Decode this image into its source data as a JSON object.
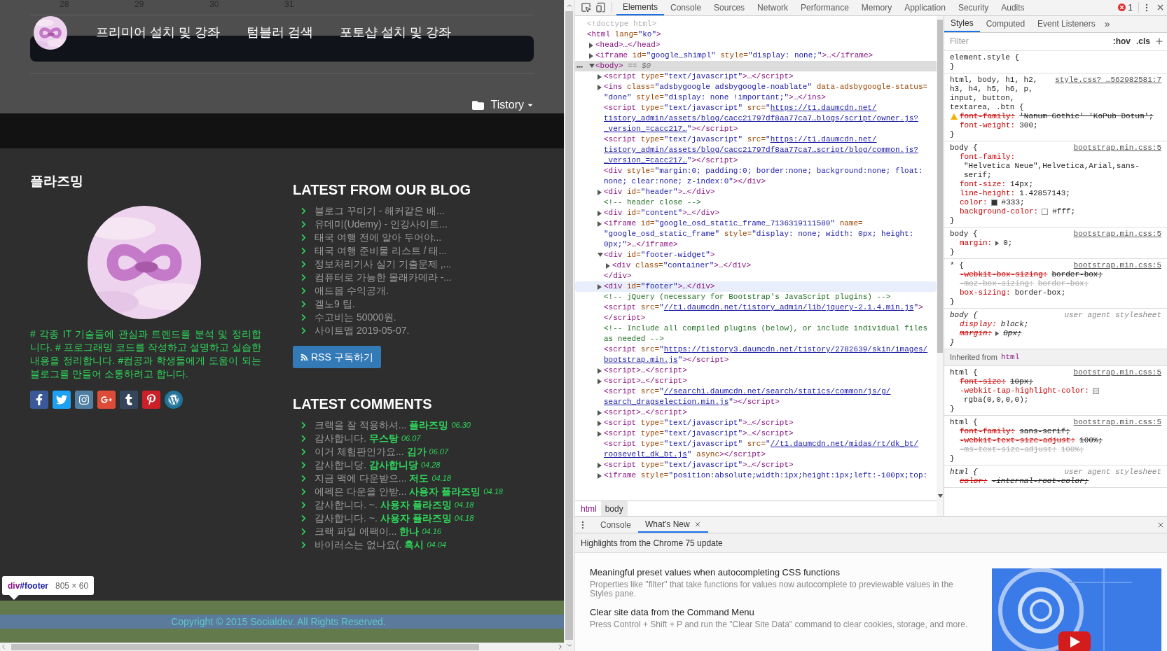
{
  "page": {
    "calendar_days": [
      "28",
      "29",
      "30",
      "31"
    ],
    "nav_items": [
      "프리미어 설치 및 강좌",
      "텀블러 검색",
      "포토샵 설치 및 강좌"
    ],
    "category": "Tistory",
    "about": {
      "title": "플라즈밍",
      "description": "# 각종 IT 기술들에 관심과 트렌드를 분석 및 정리합니다. # 프로그래밍 코드를 작성하고 설명하고 실습한 내용을 정리합니다. #컴공과 학생들에게 도움이 되는 블로그를 만들어 소통하려고 합니다."
    },
    "blog": {
      "title": "LATEST FROM OUR BLOG",
      "posts": [
        "블로그 꾸미기 - 해커같은 배...",
        "유데미(Udemy) - 인강사이트...",
        "태국 여행 전에 알아 두어야...",
        "태국 여행 준비물 리스트 / 태...",
        "정보처리기사 실기 기출문제 ,...",
        "컴퓨터로 가능한 몰래카메라 -...",
        "애드몹 수익공개.",
        "겔노9 팁.",
        "수고비는 50000원.",
        "사이트맵 2019-05-07."
      ],
      "rss_button": "RSS 구독하기"
    },
    "comments": {
      "title": "LATEST COMMENTS",
      "items": [
        {
          "text": "크랙을 잘 적용하셔...",
          "author": "플라즈밍",
          "date": "06.30"
        },
        {
          "text": "감사합니다.",
          "author": "무스탕",
          "date": "06.07"
        },
        {
          "text": "이거 체험판인가요...",
          "author": "김가",
          "date": "06.07"
        },
        {
          "text": "감사합니당.",
          "author": "감사합니당",
          "date": "04.28"
        },
        {
          "text": "지금 맥에 다운받으...",
          "author": "저도",
          "date": "04.18"
        },
        {
          "text": "에펙은 다운을 안받...",
          "author": "사용자 플라즈밍",
          "date": "04.18"
        },
        {
          "text": "감사합니다. ~.",
          "author": "사용자 플라즈밍",
          "date": "04.18"
        },
        {
          "text": "감사합니다. ~.",
          "author": "사용자 플라즈밍",
          "date": "04.18"
        },
        {
          "text": "크랙 파일 에팩이...",
          "author": "한나",
          "date": "04.16"
        },
        {
          "text": "바이러스는 없나요(.",
          "author": "혹시",
          "date": "04.04"
        }
      ]
    },
    "tooltip": {
      "tag": "div",
      "id": "#footer",
      "size": "805 × 60"
    },
    "copyright": "Copyright © 2015 Socialdev. All Rights Reserved."
  },
  "devtools": {
    "tabs": [
      {
        "label": "Elements",
        "selected": true
      },
      {
        "label": "Console",
        "selected": false
      },
      {
        "label": "Sources",
        "selected": false
      },
      {
        "label": "Network",
        "selected": false
      },
      {
        "label": "Performance",
        "selected": false
      },
      {
        "label": "Memory",
        "selected": false
      },
      {
        "label": "Application",
        "selected": false
      },
      {
        "label": "Security",
        "selected": false
      },
      {
        "label": "Audits",
        "selected": false
      }
    ],
    "error_count": "1",
    "dom": [
      {
        "parts": [
          {
            "kind": "doctype",
            "text": "<!doctype html>"
          }
        ]
      },
      {
        "parts": [
          {
            "kind": "tag",
            "text": "<html"
          },
          {
            "kind": "attr",
            "text": " lang="
          },
          {
            "kind": "value",
            "text": "\"ko\""
          },
          {
            "kind": "tag",
            "text": ">"
          }
        ],
        "children": [
          {
            "expanded": false,
            "parts": [
              {
                "kind": "tag",
                "text": "<head>…</head>"
              }
            ]
          },
          {
            "expanded": false,
            "parts": [
              {
                "kind": "tag",
                "text": "<iframe"
              },
              {
                "kind": "attr",
                "text": " id="
              },
              {
                "kind": "value",
                "text": "\"google_shimpl\""
              },
              {
                "kind": "attr",
                "text": " style="
              },
              {
                "kind": "value",
                "text": "\"display: none;\""
              },
              {
                "kind": "tag",
                "text": ">…</iframe>"
              }
            ]
          },
          {
            "expanded": true,
            "selected": true,
            "parts": [
              {
                "kind": "tag",
                "text": "<body>"
              },
              {
                "kind": "hint",
                "text": " == $0"
              }
            ],
            "children": [
              {
                "expanded": false,
                "parts": [
                  {
                    "kind": "tag",
                    "text": "<script"
                  },
                  {
                    "kind": "attr",
                    "text": " type="
                  },
                  {
                    "kind": "value",
                    "text": "\"text/javascript\""
                  },
                  {
                    "kind": "tag",
                    "text": ">…</script>"
                  }
                ]
              },
              {
                "expanded": false,
                "parts": [
                  {
                    "kind": "tag",
                    "text": "<ins"
                  },
                  {
                    "kind": "attr",
                    "text": " class="
                  },
                  {
                    "kind": "value",
                    "text": "\"adsbygoogle adsbygoogle-noablate\""
                  },
                  {
                    "kind": "attr",
                    "text": " data-adsbygoogle-status="
                  },
                  {
                    "kind": "value",
                    "text": "\"done\""
                  },
                  {
                    "kind": "attr",
                    "text": " style="
                  },
                  {
                    "kind": "value",
                    "text": "\"display: none !important;\""
                  },
                  {
                    "kind": "tag",
                    "text": ">…</ins>"
                  }
                ]
              },
              {
                "parts": [
                  {
                    "kind": "tag",
                    "text": "<script"
                  },
                  {
                    "kind": "attr",
                    "text": " type="
                  },
                  {
                    "kind": "value",
                    "text": "\"text/javascript\""
                  },
                  {
                    "kind": "attr",
                    "text": " src="
                  },
                  {
                    "kind": "value",
                    "text": "\""
                  },
                  {
                    "kind": "link",
                    "text": "https://t1.daumcdn.net/tistory_admin/assets/blog/cacc21797df8aa77ca7…blogs/script/owner.js?_version_=cacc217…"
                  },
                  {
                    "kind": "value",
                    "text": "\""
                  },
                  {
                    "kind": "tag",
                    "text": "></script>"
                  }
                ]
              },
              {
                "parts": [
                  {
                    "kind": "tag",
                    "text": "<script"
                  },
                  {
                    "kind": "attr",
                    "text": " type="
                  },
                  {
                    "kind": "value",
                    "text": "\"text/javascript\""
                  },
                  {
                    "kind": "attr",
                    "text": " src="
                  },
                  {
                    "kind": "value",
                    "text": "\""
                  },
                  {
                    "kind": "link",
                    "text": "https://t1.daumcdn.net/tistory_admin/assets/blog/cacc21797df8aa77ca7…script/blog/common.js?_version_=cacc217…"
                  },
                  {
                    "kind": "value",
                    "text": "\""
                  },
                  {
                    "kind": "tag",
                    "text": "></script>"
                  }
                ]
              },
              {
                "parts": [
                  {
                    "kind": "tag",
                    "text": "<div"
                  },
                  {
                    "kind": "attr",
                    "text": " style="
                  },
                  {
                    "kind": "value",
                    "text": "\"margin:0; padding:0; border:none; background:none; float: none; clear:none; z-index:0\""
                  },
                  {
                    "kind": "tag",
                    "text": "></div>"
                  }
                ]
              },
              {
                "expanded": false,
                "parts": [
                  {
                    "kind": "tag",
                    "text": "<div"
                  },
                  {
                    "kind": "attr",
                    "text": " id="
                  },
                  {
                    "kind": "value",
                    "text": "\"header\""
                  },
                  {
                    "kind": "tag",
                    "text": ">…</div>"
                  }
                ]
              },
              {
                "parts": [
                  {
                    "kind": "comment",
                    "text": "<!-- header close -->"
                  }
                ]
              },
              {
                "expanded": false,
                "parts": [
                  {
                    "kind": "tag",
                    "text": "<div"
                  },
                  {
                    "kind": "attr",
                    "text": " id="
                  },
                  {
                    "kind": "value",
                    "text": "\"content\""
                  },
                  {
                    "kind": "tag",
                    "text": ">…</div>"
                  }
                ]
              },
              {
                "expanded": false,
                "parts": [
                  {
                    "kind": "tag",
                    "text": "<iframe"
                  },
                  {
                    "kind": "attr",
                    "text": " id="
                  },
                  {
                    "kind": "value",
                    "text": "\"google_osd_static_frame_7136319111580\""
                  },
                  {
                    "kind": "attr",
                    "text": " name="
                  },
                  {
                    "kind": "value",
                    "text": "\"google_osd_static_frame\""
                  },
                  {
                    "kind": "attr",
                    "text": " style="
                  },
                  {
                    "kind": "value",
                    "text": "\"display: none; width: 0px; height: 0px;\""
                  },
                  {
                    "kind": "tag",
                    "text": ">…</iframe>"
                  }
                ]
              },
              {
                "expanded": true,
                "parts": [
                  {
                    "kind": "tag",
                    "text": "<div"
                  },
                  {
                    "kind": "attr",
                    "text": " id="
                  },
                  {
                    "kind": "value",
                    "text": "\"footer-widget\""
                  },
                  {
                    "kind": "tag",
                    "text": ">"
                  }
                ],
                "children": [
                  {
                    "expanded": false,
                    "parts": [
                      {
                        "kind": "tag",
                        "text": "<div"
                      },
                      {
                        "kind": "attr",
                        "text": " class="
                      },
                      {
                        "kind": "value",
                        "text": "\"container\""
                      },
                      {
                        "kind": "tag",
                        "text": ">…</div>"
                      }
                    ]
                  }
                ]
              },
              {
                "parts": [
                  {
                    "kind": "tag",
                    "text": "</div>"
                  }
                ]
              },
              {
                "expanded": false,
                "hovered": true,
                "parts": [
                  {
                    "kind": "tag",
                    "text": "<div"
                  },
                  {
                    "kind": "attr",
                    "text": " id="
                  },
                  {
                    "kind": "value",
                    "text": "\"footer\""
                  },
                  {
                    "kind": "tag",
                    "text": ">…</div>"
                  }
                ]
              },
              {
                "parts": [
                  {
                    "kind": "comment",
                    "text": "<!-- jQuery (necessary for Bootstrap's JavaScript plugins) -->"
                  }
                ]
              },
              {
                "parts": [
                  {
                    "kind": "tag",
                    "text": "<script"
                  },
                  {
                    "kind": "attr",
                    "text": " src="
                  },
                  {
                    "kind": "value",
                    "text": "\""
                  },
                  {
                    "kind": "link",
                    "text": "//t1.daumcdn.net/tistory_admin/lib/jquery-2.1.4.min.js"
                  },
                  {
                    "kind": "value",
                    "text": "\""
                  },
                  {
                    "kind": "tag",
                    "text": "> </script>"
                  }
                ]
              },
              {
                "parts": [
                  {
                    "kind": "comment",
                    "text": "<!-- Include all compiled plugins (below), or include individual files as needed -->"
                  }
                ]
              },
              {
                "parts": [
                  {
                    "kind": "tag",
                    "text": "<script"
                  },
                  {
                    "kind": "attr",
                    "text": " src="
                  },
                  {
                    "kind": "value",
                    "text": "\""
                  },
                  {
                    "kind": "link",
                    "text": "https://tistory3.daumcdn.net/tistory/2782639/skin/images/bootstrap.min.js"
                  },
                  {
                    "kind": "value",
                    "text": "\""
                  },
                  {
                    "kind": "tag",
                    "text": "></script>"
                  }
                ]
              },
              {
                "expanded": false,
                "parts": [
                  {
                    "kind": "tag",
                    "text": "<script>…</script>"
                  }
                ]
              },
              {
                "expanded": false,
                "parts": [
                  {
                    "kind": "tag",
                    "text": "<script>…</script>"
                  }
                ]
              },
              {
                "parts": [
                  {
                    "kind": "tag",
                    "text": "<script"
                  },
                  {
                    "kind": "attr",
                    "text": " src="
                  },
                  {
                    "kind": "value",
                    "text": "\""
                  },
                  {
                    "kind": "link",
                    "text": "//search1.daumcdn.net/search/statics/common/js/g/search_dragselection.min.js"
                  },
                  {
                    "kind": "value",
                    "text": "\""
                  },
                  {
                    "kind": "tag",
                    "text": "></script>"
                  }
                ]
              },
              {
                "expanded": false,
                "parts": [
                  {
                    "kind": "tag",
                    "text": "<script>…</script>"
                  }
                ]
              },
              {
                "expanded": false,
                "parts": [
                  {
                    "kind": "tag",
                    "text": "<script"
                  },
                  {
                    "kind": "attr",
                    "text": " type="
                  },
                  {
                    "kind": "value",
                    "text": "\"text/javascript\""
                  },
                  {
                    "kind": "tag",
                    "text": ">…</script>"
                  }
                ]
              },
              {
                "expanded": false,
                "parts": [
                  {
                    "kind": "tag",
                    "text": "<script"
                  },
                  {
                    "kind": "attr",
                    "text": " type="
                  },
                  {
                    "kind": "value",
                    "text": "\"text/javascript\""
                  },
                  {
                    "kind": "tag",
                    "text": ">…</script>"
                  }
                ]
              },
              {
                "parts": [
                  {
                    "kind": "tag",
                    "text": "<script"
                  },
                  {
                    "kind": "attr",
                    "text": " type="
                  },
                  {
                    "kind": "value",
                    "text": "\"text/javascript\""
                  },
                  {
                    "kind": "attr",
                    "text": " src="
                  },
                  {
                    "kind": "value",
                    "text": "\""
                  },
                  {
                    "kind": "link",
                    "text": "//t1.daumcdn.net/midas/rt/dk_bt/roosevelt_dk_bt.js"
                  },
                  {
                    "kind": "value",
                    "text": "\""
                  },
                  {
                    "kind": "attr",
                    "text": " async"
                  },
                  {
                    "kind": "tag",
                    "text": "></script>"
                  }
                ]
              },
              {
                "expanded": false,
                "parts": [
                  {
                    "kind": "tag",
                    "text": "<script"
                  },
                  {
                    "kind": "attr",
                    "text": " type="
                  },
                  {
                    "kind": "value",
                    "text": "\"text/javascript\""
                  },
                  {
                    "kind": "tag",
                    "text": ">…</script>"
                  }
                ]
              },
              {
                "expanded": false,
                "parts": [
                  {
                    "kind": "tag",
                    "text": "<iframe"
                  },
                  {
                    "kind": "attr",
                    "text": " style="
                  },
                  {
                    "kind": "value",
                    "text": "\"position:absolute;width:1px;height:1px;left:-100px;top:"
                  }
                ]
              }
            ]
          }
        ]
      }
    ],
    "breadcrumbs": [
      {
        "label": "html",
        "selected": false
      },
      {
        "label": "body",
        "selected": true
      }
    ],
    "styles_tabs": [
      {
        "label": "Styles",
        "selected": true
      },
      {
        "label": "Computed",
        "selected": false
      },
      {
        "label": "Event Listeners",
        "selected": false
      }
    ],
    "styles_more": "»",
    "filter_placeholder": "Filter",
    "filter_buttons": [
      ":hov",
      ".cls"
    ],
    "rules": [
      {
        "kind": "rule",
        "selector": "element.style {",
        "user_agent": false,
        "end": "}"
      },
      {
        "kind": "rule",
        "selector": "html, body, h1, h2, h3, h4, h5, h6, p, input, button, textarea, .btn {",
        "source": "style.css? …562982581:7",
        "user_agent": false,
        "props": [
          {
            "name": "font-family:",
            "value": "'Nanum Gothic' 'KoPub Dotum';",
            "struck": true,
            "dimmed": false,
            "warning": true
          },
          {
            "name": "font-weight:",
            "value": "300;",
            "struck": false,
            "dimmed": false
          }
        ],
        "end": "}"
      },
      {
        "kind": "rule",
        "selector": "body {",
        "source": "bootstrap.min.css:5",
        "user_agent": false,
        "props": [
          {
            "name": "font-family:",
            "value": "\"Helvetica Neue\",Helvetica,Arial,sans-serif;",
            "struck": false,
            "dimmed": false
          },
          {
            "name": "font-size:",
            "value": "14px;",
            "struck": false,
            "dimmed": false
          },
          {
            "name": "line-height:",
            "value": "1.42857143;",
            "struck": false,
            "dimmed": false
          },
          {
            "name": "color:",
            "value": "#333;",
            "struck": false,
            "dimmed": false,
            "color": "#333333"
          },
          {
            "name": "background-color:",
            "value": "#fff;",
            "struck": false,
            "dimmed": false,
            "color": "#ffffff"
          }
        ],
        "end": "}"
      },
      {
        "kind": "rule",
        "selector": "body {",
        "source": "bootstrap.min.css:5",
        "user_agent": false,
        "props": [
          {
            "name": "margin:",
            "value": "0;",
            "struck": false,
            "dimmed": false,
            "expandable": true
          }
        ],
        "end": "}"
      },
      {
        "kind": "rule",
        "selector": "* {",
        "source": "bootstrap.min.css:5",
        "user_agent": false,
        "props": [
          {
            "name": "-webkit-box-sizing:",
            "value": "border-box;",
            "struck": true,
            "dimmed": false
          },
          {
            "name": "-moz-box-sizing:",
            "value": "border-box;",
            "struck": true,
            "dimmed": true
          },
          {
            "name": "box-sizing:",
            "value": "border-box;",
            "struck": false,
            "dimmed": false
          }
        ],
        "end": "}"
      },
      {
        "kind": "rule",
        "selector": "body {",
        "source": "user agent stylesheet",
        "user_agent": true,
        "props": [
          {
            "name": "display:",
            "value": "block;",
            "struck": false,
            "dimmed": false
          },
          {
            "name": "margin:",
            "value": "8px;",
            "struck": true,
            "dimmed": false,
            "expandable": true
          }
        ],
        "end": "}"
      },
      {
        "kind": "inherited",
        "label": "Inherited from",
        "element": "html"
      },
      {
        "kind": "rule",
        "selector": "html {",
        "source": "bootstrap.min.css:5",
        "user_agent": false,
        "props": [
          {
            "name": "font-size:",
            "value": "10px;",
            "struck": true,
            "dimmed": false
          },
          {
            "name": "-webkit-tap-highlight-color:",
            "value": "rgba(0,0,0,0);",
            "struck": false,
            "dimmed": false,
            "checker_swatch": true
          }
        ],
        "end": "}"
      },
      {
        "kind": "rule",
        "selector": "html {",
        "source": "bootstrap.min.css:5",
        "user_agent": false,
        "props": [
          {
            "name": "font-family:",
            "value": "sans-serif;",
            "struck": true,
            "dimmed": false
          },
          {
            "name": "-webkit-text-size-adjust:",
            "value": "100%;",
            "struck": true,
            "dimmed": false
          },
          {
            "name": "-ms-text-size-adjust:",
            "value": "100%;",
            "struck": true,
            "dimmed": true
          }
        ],
        "end": "}"
      },
      {
        "kind": "rule",
        "selector": "html {",
        "source": "user agent stylesheet",
        "user_agent": true,
        "props": [
          {
            "name": "color:",
            "value": "-internal-root-color;",
            "struck": true,
            "dimmed": false
          }
        ]
      }
    ],
    "drawer": {
      "tabs": [
        {
          "label": "Console",
          "selected": false,
          "closable": false
        },
        {
          "label": "What's New",
          "selected": true,
          "closable": true
        }
      ],
      "header": "Highlights from the Chrome 75 update",
      "items": [
        {
          "title": "Meaningful preset values when autocompleting CSS functions",
          "body": "Properties like \"filter\" that take functions for values now autocomplete to previewable values in the Styles pane."
        },
        {
          "title": "Clear site data from the Command Menu",
          "body": "Press Control + Shift + P and run the \"Clear Site Data\" command to clear cookies, storage, and more."
        }
      ]
    }
  }
}
